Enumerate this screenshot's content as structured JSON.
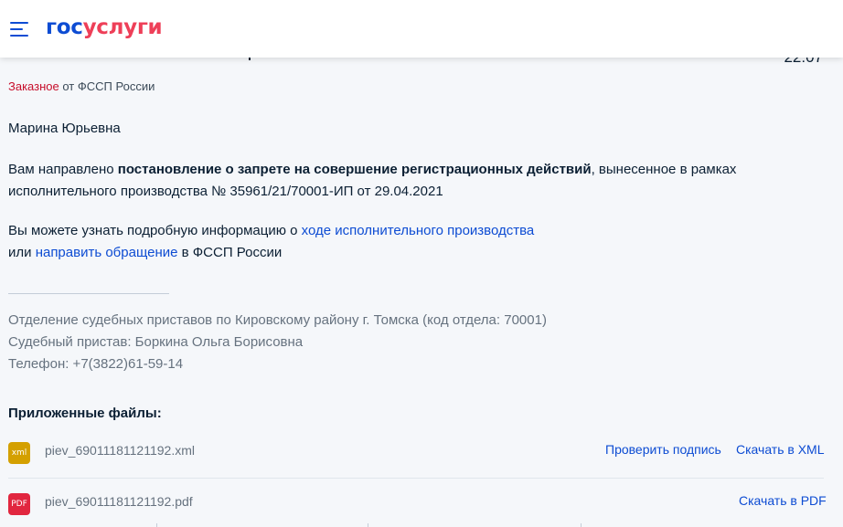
{
  "header": {
    "logo_part1": "гос",
    "logo_part2": "услуги",
    "brand_color_primary": "#0d4cd3",
    "brand_color_secondary": "#ee3f58",
    "menu_icon": "burger-menu-icon"
  },
  "message": {
    "time": "22:07",
    "kind": "Заказное",
    "from": " от ФССП России",
    "greeting": "Марина Юрьевна",
    "para1_prefix": "Вам направлено ",
    "para1_bold": "постановление о запрете на совершение регистрационных действий",
    "para1_suffix": ", вынесенное в рамках исполнительного производства № 35961/21/70001-ИП от 29.04.2021",
    "para2_prefix": "Вы можете узнать подробную информацию о ",
    "para2_link1": "ходе исполнительного производства",
    "para2_middle": "или ",
    "para2_link2": "направить обращение",
    "para2_suffix": " в ФССП России",
    "signature": [
      "Отделение судебных приставов по Кировскому району г. Томска (код отдела: 70001)",
      "Судебный пристав: Боркина Ольга Борисовна",
      "Телефон: +7(3822)61-59-14"
    ]
  },
  "attachments": {
    "title": "Приложенные файлы:",
    "files": [
      {
        "badge": "xml",
        "badge_color": "#d4a000",
        "name": "piev_69011181121192.xml",
        "actions": [
          "Проверить подпись",
          "Скачать в XML"
        ]
      },
      {
        "badge": "PDF",
        "badge_color": "#e1263f",
        "name": "piev_69011181121192.pdf",
        "actions": [
          "Скачать в PDF"
        ]
      }
    ]
  }
}
